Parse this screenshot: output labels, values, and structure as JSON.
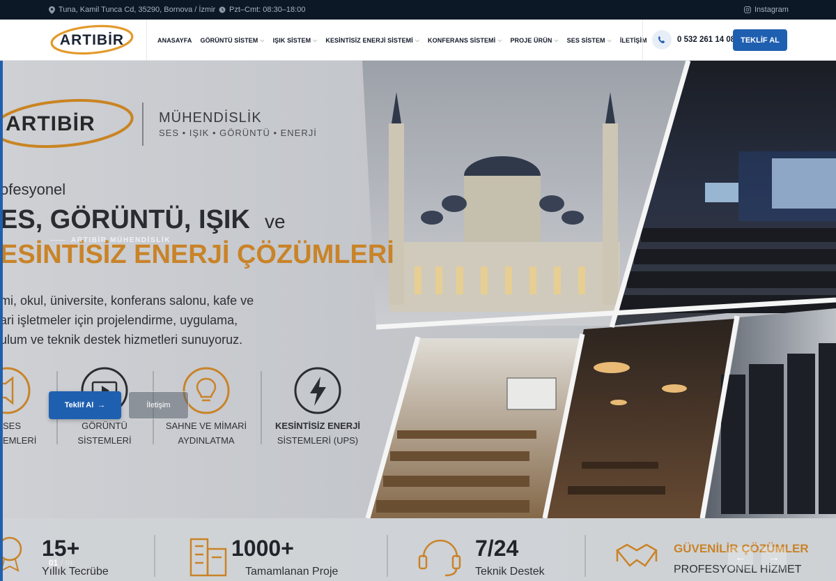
{
  "topbar": {
    "address": "Tuna, Kamil Tunca Cd, 35290, Bornova / İzmir",
    "hours": "Pzt–Cmt: 08:30–18:00",
    "social": "Instagram"
  },
  "nav": {
    "logo_text": "ARTIBİR",
    "items": [
      {
        "label": "ANASAYFA",
        "dropdown": false
      },
      {
        "label": "GÖRÜNTÜ SİSTEM",
        "dropdown": true
      },
      {
        "label": "IŞIK SİSTEM",
        "dropdown": true
      },
      {
        "label": "KESİNTİSİZ ENERJİ SİSTEMİ",
        "dropdown": true
      },
      {
        "label": "KONFERANS SİSTEMİ",
        "dropdown": true
      },
      {
        "label": "PROJE ÜRÜN",
        "dropdown": true
      },
      {
        "label": "SES SİSTEM",
        "dropdown": true
      },
      {
        "label": "İLETİŞİM",
        "dropdown": false
      }
    ],
    "phone": "0 532 261 14 08",
    "quote_button": "TEKLİF AL"
  },
  "hero": {
    "eyebrow": "ARTIBİR MÜHENDİSLİK",
    "cta_primary": "Teklif Al",
    "cta_secondary": "İletişim",
    "slide_current": "01",
    "slide_separator": "/",
    "slide_total": "01",
    "banner": {
      "brand": "ARTIBİR",
      "division": "MÜHENDİSLİK",
      "tagline": "SES • IŞIK • GÖRÜNTÜ • ENERJİ",
      "line1": "ofesyonel",
      "line2a": "ES, GÖRÜNTÜ, IŞIK",
      "line2b": "ve",
      "line3": "ESİNTİSİZ ENERJİ ÇÖZÜMLERİ",
      "desc1": "mi, okul, üniversite, konferans salonu, kafe ve",
      "desc2": "ari işletmeler için projelendirme, uygulama,",
      "desc3": "ulum ve teknik destek hizmetleri sunuyoruz.",
      "services": [
        {
          "l1": "SES",
          "l2": "EMLERİ"
        },
        {
          "l1": "GÖRÜNTÜ",
          "l2": "SİSTEMLERİ"
        },
        {
          "l1": "SAHNE VE MİMARİ",
          "l2": "AYDINLATMA"
        },
        {
          "l1": "KESİNTİSİZ ENERJİ",
          "l2": "SİSTEMLERİ (UPS)"
        }
      ],
      "stats": [
        {
          "num": "15+",
          "label": "Yıllık Tecrübe"
        },
        {
          "num": "1000+",
          "label": "Tamamlanan Proje"
        },
        {
          "num": "7/24",
          "label": "Teknik Destek"
        },
        {
          "num": "GÜVENİLİR ÇÖZÜMLER",
          "label": "PROFESYONEL HİZMET"
        }
      ]
    }
  },
  "colors": {
    "topbar_bg": "#0d1826",
    "primary": "#1f5fb0",
    "accent_orange": "#e39a2c"
  }
}
